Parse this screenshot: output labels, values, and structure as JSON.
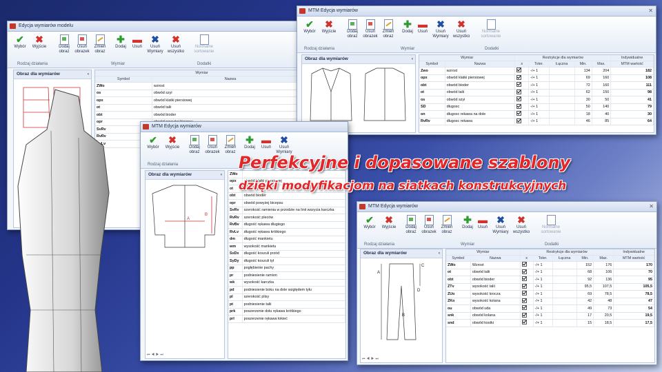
{
  "ribbon": {
    "buttons": [
      "Wybór",
      "Wyjście",
      "Dodaj obraz",
      "Usuń obrazek",
      "Zmień obraz",
      "Dodaj",
      "Usuń",
      "Usuń Wymiary",
      "Usuń wszystko",
      "Normalne sortowanie"
    ],
    "groups": {
      "rodzaj": "Rodzaj działania",
      "wymiar": "Wymiar",
      "dodatki": "Dodatki"
    }
  },
  "common": {
    "panel_title": "Obraz dla wymiarów",
    "wymiar_header": "Wymiar",
    "symbol_header": "Symbol",
    "nazwa_header": "Nazwa",
    "restr_header": "Restrykcje dla wymiarów",
    "indyw_header": "Indywidualne",
    "x": "x",
    "toler": "Toler.",
    "laczna": "Łączna",
    "min": "Min.",
    "max": "Max.",
    "mtm": "MTM wartość"
  },
  "win1": {
    "title": "Edycja wymiarów modelu",
    "rows": [
      [
        "ZWo",
        "wzrost"
      ],
      [
        "os",
        "obwód szyi"
      ],
      [
        "opx",
        "obwód klatki piersiowej"
      ],
      [
        "ot",
        "obwód talii"
      ],
      [
        "obt",
        "obwód bioder"
      ],
      [
        "opr",
        "obwód powyżej bicepsu"
      ],
      [
        "SvRv",
        ""
      ],
      [
        "RvRv",
        ""
      ],
      [
        "RvLv",
        ""
      ]
    ]
  },
  "win2": {
    "title": "MTM Edycja wymiarów",
    "rows": [
      [
        "Zwo",
        "wzrost",
        "-/+ 1",
        "134",
        "204",
        "182"
      ],
      [
        "opx",
        "obwód klatki piersiowej",
        "-/+ 1",
        "69",
        "160",
        "108"
      ],
      [
        "obt",
        "obwód bioder",
        "-/+ 1",
        "72",
        "160",
        "111"
      ],
      [
        "ot",
        "obwód talii",
        "-/+ 1",
        "62",
        "150",
        "98"
      ],
      [
        "os",
        "obwód szyi",
        "-/+ 1",
        "30",
        "50",
        "41"
      ],
      [
        "SD",
        "długosc",
        "-/+ 1",
        "50",
        "140",
        "79"
      ],
      [
        "on",
        "długosc rekawa na dole",
        "-/+ 1",
        "18",
        "40",
        "30"
      ],
      [
        "RvRv",
        "długosc rekawa",
        "-/+ 1",
        "46",
        "85",
        "64"
      ]
    ]
  },
  "win3": {
    "title": "MTM Edycja wymiarów",
    "rows": [
      [
        "ZWo",
        ""
      ],
      [
        "opx",
        "obwód klatki piersiowej"
      ],
      [
        "ot",
        "obwód talii"
      ],
      [
        "obt",
        "obwód bioder"
      ],
      [
        "opr",
        "obwód powyżej bicepsu"
      ],
      [
        "SvRv",
        "szerokość ramienia w przodzie na linii wszycia karczka"
      ],
      [
        "RvRv",
        "szerokość pleców"
      ],
      [
        "RvBv",
        "długość rękawa długiego"
      ],
      [
        "RvLv",
        "długość rękawa krótkiego"
      ],
      [
        "dm",
        "długość mankietu"
      ],
      [
        "wm",
        "wysokość mankietu"
      ],
      [
        "SxDx",
        "długość koszuli przód"
      ],
      [
        "SyDy",
        "długość koszuli tył"
      ],
      [
        "pp",
        "pogłębienie pachy"
      ],
      [
        "pr",
        "podniesienie ramion"
      ],
      [
        "wk",
        "wysokość karczka"
      ],
      [
        "pd",
        "podniesienie boku na dole względem tyłu"
      ],
      [
        "pl",
        "szerokość plisy"
      ],
      [
        "pt",
        "podniesienie talii"
      ],
      [
        "prk",
        "poszerzenie dołu rękawa krótkiego"
      ],
      [
        "prl",
        "poszerzenie rękawa łokieć"
      ]
    ]
  },
  "win4": {
    "title": "MTM Edycja wymiarów",
    "rows": [
      [
        "ZWo",
        "Wzrost",
        "-/+ 1",
        "152",
        "176",
        "170"
      ],
      [
        "ot",
        "obwód talii",
        "-/+ 1",
        "68",
        "106",
        "70"
      ],
      [
        "obt",
        "obwód bioder",
        "-/+ 1",
        "92",
        "136",
        "95"
      ],
      [
        "ZTv",
        "wysokość talii",
        "-/+ 1",
        "95,5",
        "107,5",
        "105,5"
      ],
      [
        "ZUo",
        "wysokość krocza",
        "-/+ 1",
        "69",
        "78,5",
        "78,5"
      ],
      [
        "ZKo",
        "wysokość kolana",
        "-/+ 1",
        "42",
        "48",
        "47"
      ],
      [
        "ou",
        "obwód uda",
        "-/+ 1",
        "49",
        "73",
        "54"
      ],
      [
        "snk",
        "obwód kolana",
        "-/+ 1",
        "17",
        "20,5",
        "19,5"
      ],
      [
        "snd",
        "obwód kostki",
        "-/+ 1",
        "15",
        "18,5",
        "17,5"
      ]
    ]
  },
  "headline": {
    "line1": "Perfekcyjne i dopasowane szablony",
    "line2": "dzięki modyfikacjom na siatkach konstrukcyjnych"
  },
  "colors": {
    "accent": "#e3262a",
    "background": "#24358a"
  }
}
